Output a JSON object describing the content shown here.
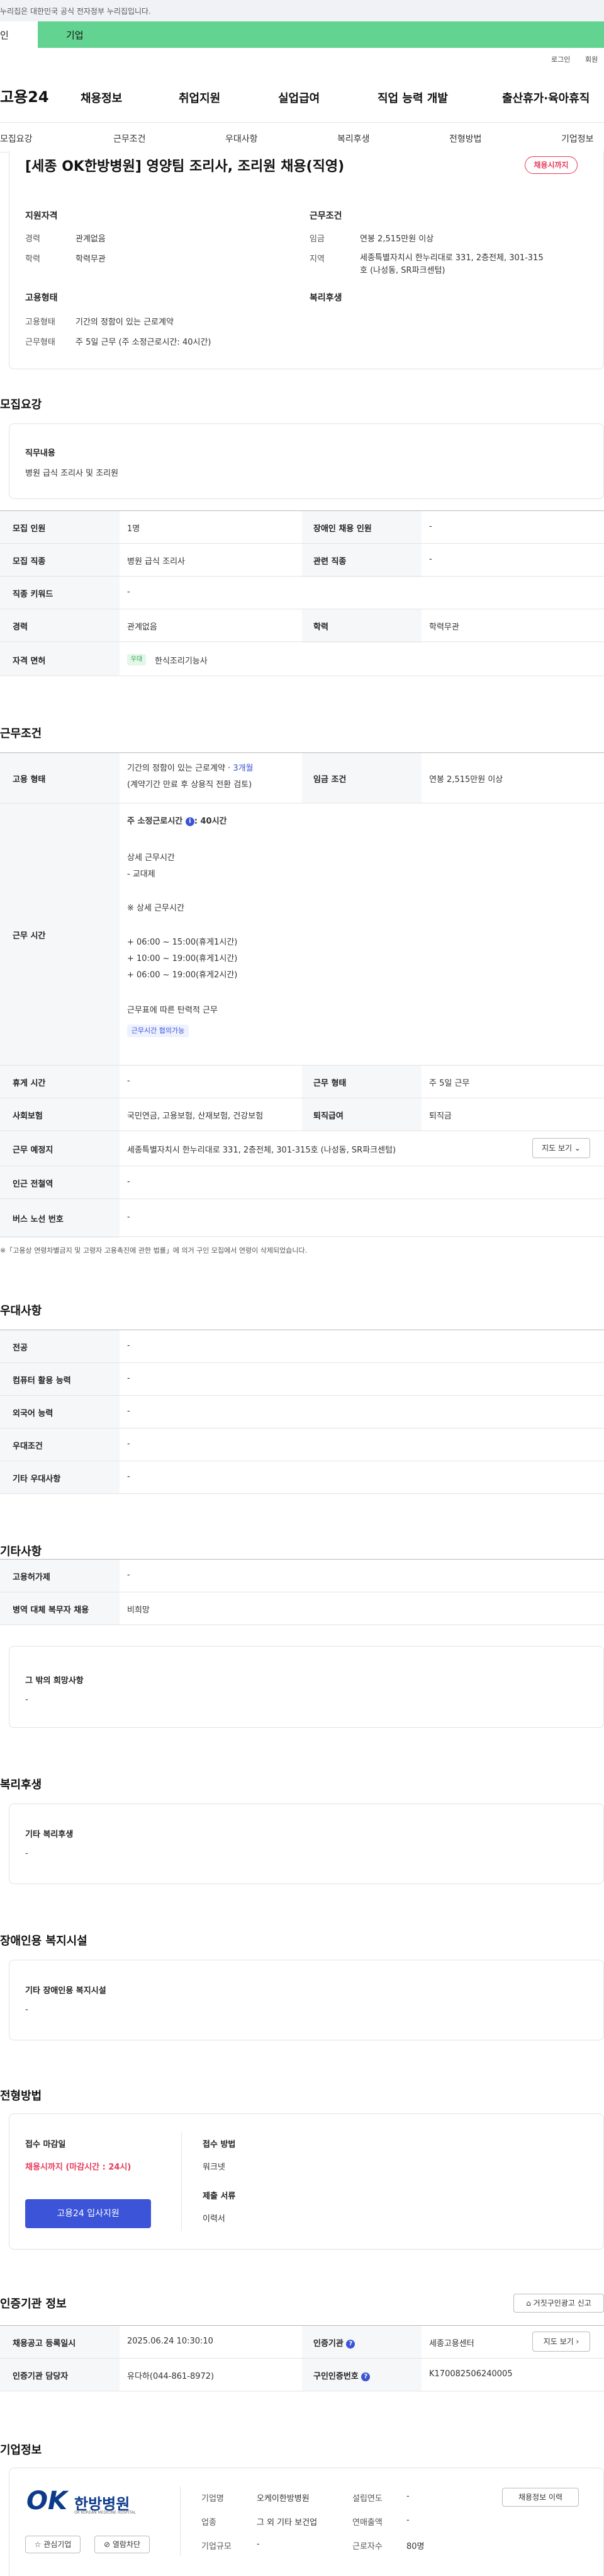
{
  "gov_banner": "누리집은 대한민국 공식 전자정부 누리집입니다.",
  "tabs": {
    "person": "인",
    "corp": "기업"
  },
  "util": {
    "login": "로그인",
    "join": "회원"
  },
  "logo": "고용24",
  "gnb": [
    "채용정보",
    "취업지원",
    "실업급여",
    "직업 능력 개발",
    "출산휴가·육아휴직"
  ],
  "lnb": [
    "모집요강",
    "근무조건",
    "우대사항",
    "복리후생",
    "전형방법",
    "기업정보"
  ],
  "job": {
    "title": "[세종 OK한방병원] 영양팀 조리사, 조리원 채용(직영)",
    "status_badge": "채용시까지",
    "qual_header": "지원자격",
    "career_label": "경력",
    "career_value": "관계없음",
    "edu_label": "학력",
    "edu_value": "학력무관",
    "work_header": "근무조건",
    "wage_label": "임금",
    "wage_value": "연봉 2,515만원 이상",
    "region_label": "지역",
    "region_value_1": "세종특별자치시 한누리대로 331, 2층전체, 301-315",
    "region_value_2": "호 (나성동, SR파크센텀)",
    "emp_header": "고용형태",
    "emp_type_label": "고용형태",
    "emp_type_value": "기간의 정함이 있는 근로계약",
    "work_form_label": "근무형태",
    "work_form_value": "주 5일 근무 (주 소정근로시간: 40시간)",
    "welfare_header": "복리후생"
  },
  "recruit": {
    "section_title": "모집요강",
    "duty_label": "직무내용",
    "duty_value": "병원 급식 조리사 및 조리원",
    "rows": {
      "count_label": "모집 인원",
      "count_value": "1명",
      "disabled_label": "장애인 채용 인원",
      "disabled_value": "-",
      "job_label": "모집 직종",
      "job_value": "병원 급식 조리사",
      "related_label": "관련 직종",
      "related_value": "-",
      "keyword_label": "직종 키워드",
      "keyword_value": "-",
      "career_label": "경력",
      "career_value": "관계없음",
      "edu_label": "학력",
      "edu_value": "학력무관",
      "license_label": "자격 면허",
      "license_tag": "우대",
      "license_value": "한식조리기능사"
    }
  },
  "conditions": {
    "section_title": "근무조건",
    "emp_label": "고용 형태",
    "emp_value_prefix": "기간의 정함이 있는 근로계약 · ",
    "emp_value_link": "3개월",
    "emp_value_2": "(계약기간 만료 후 상용직 전환 검토)",
    "wage_label": "임금 조건",
    "wage_value": "연봉 2,515만원 이상",
    "hours_label": "근무 시간",
    "hours_main": "주 소정근로시간",
    "hours_info": "i",
    "hours_main_value": ": 40시간",
    "detail_title": "상세 근무시간",
    "detail_1": "- 교대제",
    "detail_2": "※ 상세 근무시간",
    "detail_3": "+ 06:00 ~ 15:00(휴게1시간)",
    "detail_4": "+ 10:00 ~ 19:00(휴게1시간)",
    "detail_5": "+ 06:00 ~ 19:00(휴게2시간)",
    "detail_6": "근무표에 따른 탄력적 근무",
    "flex_tag": "근무시간 협의가능",
    "break_label": "휴게 시간",
    "break_value": "-",
    "form_label": "근무 형태",
    "form_value": "주 5일 근무",
    "insurance_label": "사회보험",
    "insurance_value": "국민연금, 고용보험, 산재보험, 건강보험",
    "retire_label": "퇴직급여",
    "retire_value": "퇴직금",
    "place_label": "근무 예정지",
    "place_value": "세종특별자치시 한누리대로 331, 2층전체, 301-315호 (나성동, SR파크센텀)",
    "map_button": "지도 보기",
    "subway_label": "인근 전철역",
    "subway_value": "-",
    "bus_label": "버스 노선 번호",
    "bus_value": "-",
    "footnote": "※「고용상 연령차별금지 및 고령자 고용촉진에 관한 법률」에 의거 구인 모집에서 연령이 삭제되었습니다."
  },
  "pref": {
    "section_title": "우대사항",
    "major_label": "전공",
    "major_value": "-",
    "pc_label": "컴퓨터 활용 능력",
    "pc_value": "-",
    "lang_label": "외국어 능력",
    "lang_value": "-",
    "cond_label": "우대조건",
    "cond_value": "-",
    "etc_label": "기타 우대사항",
    "etc_value": "-"
  },
  "other": {
    "section_title": "기타사항",
    "hire_label": "고용허가제",
    "hire_value": "-",
    "army_label": "병역 대체 복무자 채용",
    "army_value": "비희망",
    "misc_label": "그 밖의 희망사항",
    "misc_value": "-"
  },
  "welfare": {
    "section_title": "복리후생",
    "label": "기타 복리후생",
    "value": "-"
  },
  "facility": {
    "section_title": "장애인용 복지시설",
    "label": "기타 장애인용 복지시설",
    "value": "-"
  },
  "screening": {
    "section_title": "전형방법",
    "deadline_label": "접수 마감일",
    "deadline_value": "채용시까지 (마감시간 : 24시)",
    "apply_button": "고용24 입사지원",
    "method_label": "접수 방법",
    "method_value": "워크넷",
    "docs_label": "제출 서류",
    "docs_value": "이력서"
  },
  "agency": {
    "section_title": "인증기관 정보",
    "report_button": "거짓구인광고 신고",
    "reg_label": "채용공고 등록일시",
    "reg_value": "2025.06.24 10:30:10",
    "org_label": "인증기관",
    "org_value": "세종고용센터",
    "map_button": "지도 보기",
    "manager_label": "인증기관 담당자",
    "manager_value": "유다하(044-861-8972)",
    "auth_no_label": "구인인증번호",
    "auth_no_value": "K170082506240005"
  },
  "company": {
    "section_title": "기업정보",
    "logo_ok": "OK",
    "logo_name": "한방병원",
    "logo_sub": "OK KOREAN MEDICINE HOSPITAL",
    "name_label": "기업명",
    "name_value": "오케이한방병원",
    "founded_label": "설립연도",
    "founded_value": "-",
    "industry_label": "업종",
    "industry_value": "그 외 기타 보건업",
    "revenue_label": "연매출액",
    "revenue_value": "-",
    "size_label": "기업규모",
    "size_value": "-",
    "staff_label": "근로자수",
    "staff_value": "80명",
    "history_button": "채용정보 이력",
    "fav_button": "관심기업",
    "block_button": "열람차단"
  }
}
